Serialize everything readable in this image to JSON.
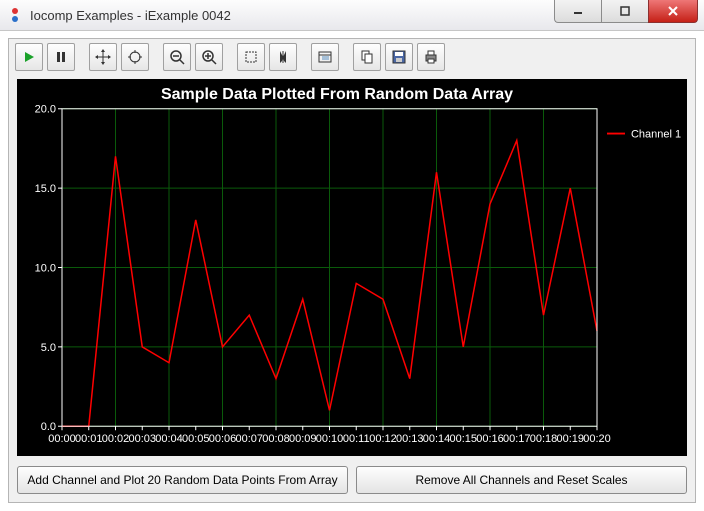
{
  "window": {
    "title": "Iocomp Examples - iExample 0042"
  },
  "buttons": {
    "add": "Add Channel and Plot 20 Random Data Points From Array",
    "remove": "Remove All Channels and Reset Scales"
  },
  "legend": {
    "items": [
      {
        "name": "Channel 1",
        "color": "#ff0000"
      }
    ]
  },
  "chart_data": {
    "type": "line",
    "title": "Sample Data Plotted From Random Data Array",
    "xlabel": "",
    "ylabel": "",
    "ylim": [
      0,
      20
    ],
    "yticks": [
      0.0,
      5.0,
      10.0,
      15.0,
      20.0
    ],
    "xlim": [
      0,
      20
    ],
    "x": [
      0,
      1,
      2,
      3,
      4,
      5,
      6,
      7,
      8,
      9,
      10,
      11,
      12,
      13,
      14,
      15,
      16,
      17,
      18,
      19,
      20
    ],
    "xticklabels": [
      "00:00",
      "00:01",
      "00:02",
      "00:03",
      "00:04",
      "00:05",
      "00:06",
      "00:07",
      "00:08",
      "00:09",
      "00:10",
      "00:11",
      "00:12",
      "00:13",
      "00:14",
      "00:15",
      "00:16",
      "00:17",
      "00:18",
      "00:19",
      "00:20"
    ],
    "series": [
      {
        "name": "Channel 1",
        "color": "#ff0000",
        "values": [
          0,
          0,
          17,
          5,
          4,
          13,
          5,
          7,
          3,
          8,
          1,
          9,
          8,
          3,
          16,
          5,
          14,
          18,
          7,
          15,
          6
        ]
      }
    ]
  }
}
